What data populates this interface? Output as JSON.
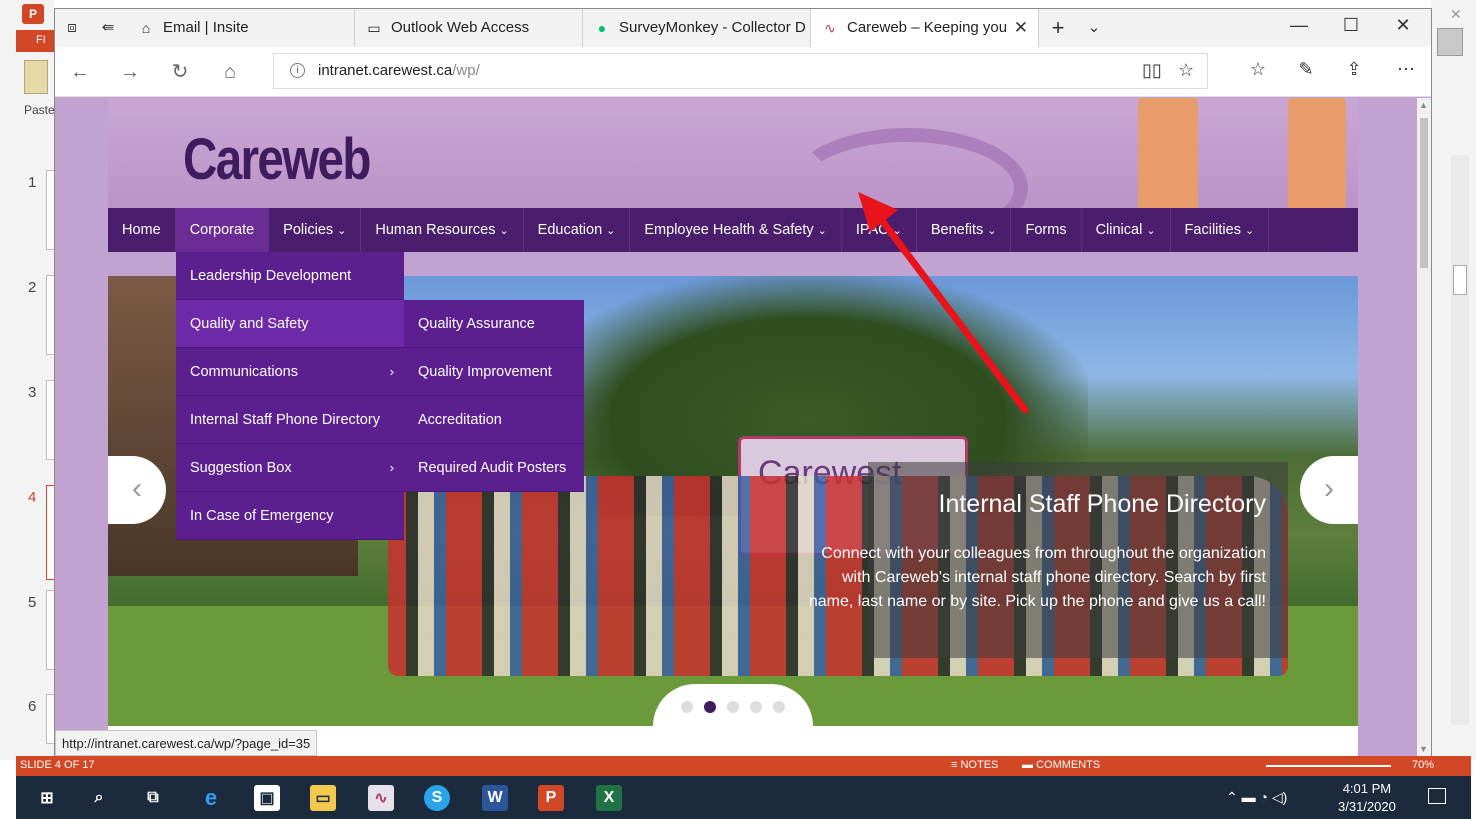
{
  "powerpoint": {
    "ribbon_tab": "FI",
    "paste_label": "Paste",
    "slide_numbers": [
      "1",
      "2",
      "3",
      "4",
      "5",
      "6"
    ],
    "active_slide": "4",
    "status": {
      "slide_info": "SLIDE 4 OF 17",
      "notes": "NOTES",
      "comments": "COMMENTS",
      "zoom": "70%"
    }
  },
  "browser": {
    "tabs": [
      {
        "title": "Email | Insite",
        "icon": "home-icon"
      },
      {
        "title": "Outlook Web Access",
        "icon": "page-icon"
      },
      {
        "title": "SurveyMonkey - Collector D",
        "icon": "surveymonkey-icon"
      },
      {
        "title": "Careweb – Keeping you",
        "icon": "careweb-icon",
        "active": true
      }
    ],
    "address": {
      "host": "intranet.carewest.ca",
      "path": "/wp/"
    },
    "status_link": "http://intranet.carewest.ca/wp/?page_id=35"
  },
  "site": {
    "logo": "Careweb",
    "nav": [
      {
        "label": "Home",
        "has_children": false
      },
      {
        "label": "Corporate",
        "has_children": false,
        "active": true
      },
      {
        "label": "Policies",
        "has_children": true
      },
      {
        "label": "Human Resources",
        "has_children": true
      },
      {
        "label": "Education",
        "has_children": true
      },
      {
        "label": "Employee Health & Safety",
        "has_children": true
      },
      {
        "label": "IPAC",
        "has_children": true
      },
      {
        "label": "Benefits",
        "has_children": true
      },
      {
        "label": "Forms",
        "has_children": false
      },
      {
        "label": "Clinical",
        "has_children": true
      },
      {
        "label": "Facilities",
        "has_children": true
      }
    ],
    "corporate_menu": [
      {
        "label": "Leadership Development",
        "has_sub": false
      },
      {
        "label": "Quality and Safety",
        "has_sub": false,
        "highlighted": true
      },
      {
        "label": "Communications",
        "has_sub": true
      },
      {
        "label": "Internal Staff Phone Directory",
        "has_sub": false
      },
      {
        "label": "Suggestion Box",
        "has_sub": true
      },
      {
        "label": "In Case of Emergency",
        "has_sub": false
      }
    ],
    "quality_submenu": [
      {
        "label": "Quality Assurance"
      },
      {
        "label": "Quality Improvement"
      },
      {
        "label": "Accreditation"
      },
      {
        "label": "Required Audit Posters"
      }
    ],
    "slide": {
      "sign_text": "Carewest",
      "title": "Internal Staff Phone Directory",
      "body": "Connect with your colleagues from throughout the organization with Careweb's internal staff phone directory. Search by first name, last name or by site. Pick up the phone and give us a call!",
      "dot_count": 5,
      "active_dot": 2
    }
  },
  "taskbar": {
    "time": "4:01 PM",
    "date": "3/31/2020"
  },
  "colors": {
    "nav_bg": "#4a1e6c",
    "menu_bg": "#5c1f90",
    "ppt_accent": "#d24726",
    "annotation_arrow": "#e8131b"
  }
}
